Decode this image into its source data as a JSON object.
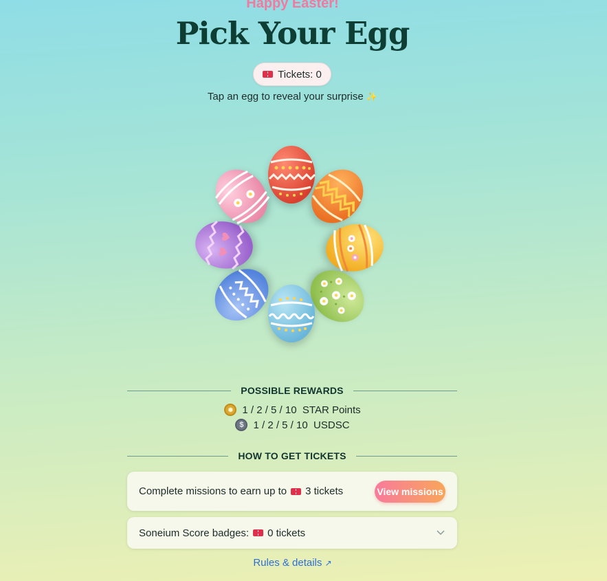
{
  "header": {
    "greeting": "Happy Easter!",
    "title": "Pick Your Egg",
    "tickets_label": "Tickets: 0",
    "subtitle": "Tap an egg to reveal your surprise"
  },
  "eggs": [
    {
      "name": "red",
      "base": "#ee5a48"
    },
    {
      "name": "orange",
      "base": "#f58a3a"
    },
    {
      "name": "yellow",
      "base": "#f7c43e"
    },
    {
      "name": "green",
      "base": "#a9d16a"
    },
    {
      "name": "light-blue",
      "base": "#84c9e6"
    },
    {
      "name": "blue",
      "base": "#6e9ae6"
    },
    {
      "name": "purple",
      "base": "#b27fdc"
    },
    {
      "name": "pink",
      "base": "#f2a0bd"
    }
  ],
  "rewards": {
    "heading": "POSSIBLE REWARDS",
    "items": [
      {
        "icon": "star-points-icon",
        "text": "1 / 2 / 5 / 10  STAR Points"
      },
      {
        "icon": "usdsc-icon",
        "text": "1 / 2 / 5 / 10  USDSC"
      }
    ]
  },
  "get_tickets": {
    "heading": "HOW TO GET TICKETS",
    "missions_prefix": "Complete missions to earn up to",
    "missions_suffix": "3 tickets",
    "missions_button": "View missions",
    "badges_prefix": "Soneium Score badges:",
    "badges_suffix": "0 tickets"
  },
  "footer": {
    "rules_label": "Rules & details",
    "rules_arrow": "↗"
  },
  "colors": {
    "title": "#0e3d34",
    "greeting": "#f07aa0",
    "link": "#2c6fd6",
    "button_gradient_start": "#f87b9c",
    "button_gradient_end": "#f8a65a"
  }
}
